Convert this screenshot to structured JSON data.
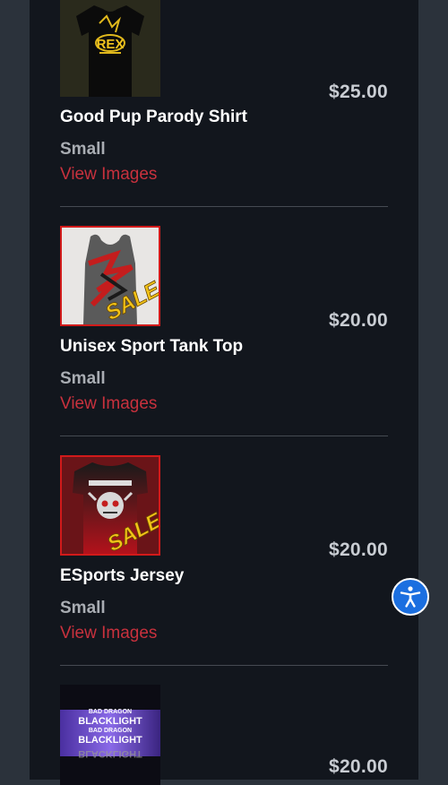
{
  "products": [
    {
      "name": "Good Pup Parody Shirt",
      "price": "$25.00",
      "size": "Small",
      "view_label": "View Images",
      "thumb_text": "REX",
      "on_sale": false
    },
    {
      "name": "Unisex Sport Tank Top",
      "price": "$20.00",
      "size": "Small",
      "view_label": "View Images",
      "thumb_text": "SALE",
      "on_sale": true
    },
    {
      "name": "ESports Jersey",
      "price": "$20.00",
      "size": "Small",
      "view_label": "View Images",
      "thumb_text": "SALE",
      "on_sale": true
    },
    {
      "price": "$20.00",
      "thumb_text": [
        "BAD DRAGON",
        "BLACKLIGHT",
        "BAD DRAGON",
        "BLACKLIGHT",
        "BLACKLIGHT"
      ]
    }
  ],
  "accessibility_button": {
    "icon": "accessibility-person-icon"
  },
  "colors": {
    "background": "#2b323b",
    "panel": "#12161d",
    "link": "#c8313d",
    "sale_border": "#d11a1a",
    "accessibility": "#1b6fe0"
  }
}
